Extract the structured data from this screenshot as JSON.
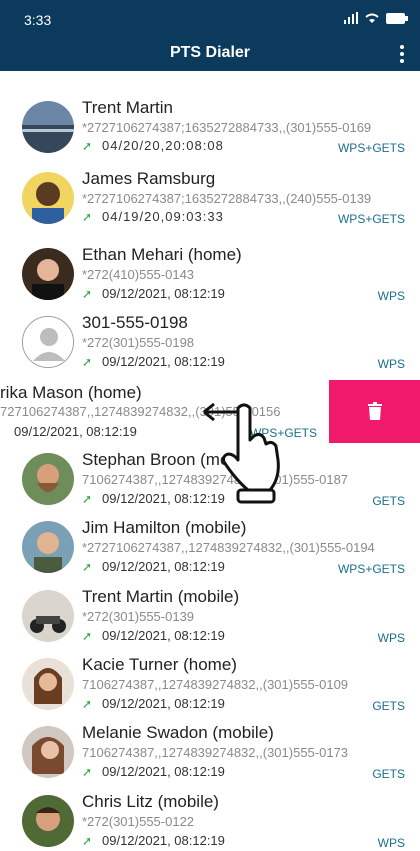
{
  "status": {
    "time": "3:33"
  },
  "appbar": {
    "title": "PTS Dialer"
  },
  "contacts": [
    {
      "name": "Trent Martin",
      "number": "*2727106274387;1635272884733,,(301)555-0169",
      "date": "04/20/20,20:08:08",
      "tag": "WPS+GETS"
    },
    {
      "name": "James Ramsburg",
      "number": "*2727106274387;1635272884733,,(240)555-0139",
      "date": "04/19/20,09:03:33",
      "tag": "WPS+GETS"
    },
    {
      "name": "Ethan Mehari (home)",
      "number": "*272(410)555-0143",
      "date": "09/12/2021, 08:12:19",
      "tag": "WPS"
    },
    {
      "name": "301-555-0198",
      "number": "*272(301)555-0198",
      "date": "09/12/2021, 08:12:19",
      "tag": "WPS"
    },
    {
      "name": "rika Mason (home)",
      "number": "727106274387,,1274839274832,,(301)555-0156",
      "date": "09/12/2021, 08:12:19",
      "tag": "WPS+GETS"
    },
    {
      "name": "Stephan Broon (mobile)",
      "number": "7106274387,,1274839274832,,(301)555-0187",
      "date": "09/12/2021, 08:12:19",
      "tag": "GETS"
    },
    {
      "name": "Jim Hamilton (mobile)",
      "number": "*2727106274387,,1274839274832,,(301)555-0194",
      "date": "09/12/2021, 08:12:19",
      "tag": "WPS+GETS"
    },
    {
      "name": "Trent Martin (mobile)",
      "number": "*272(301)555-0139",
      "date": "09/12/2021, 08:12:19",
      "tag": "WPS"
    },
    {
      "name": "Kacie Turner (home)",
      "number": "7106274387,,1274839274832,,(301)555-0109",
      "date": "09/12/2021, 08:12:19",
      "tag": "GETS"
    },
    {
      "name": "Melanie Swadon (mobile)",
      "number": "7106274387,,1274839274832,,(301)555-0173",
      "date": "09/12/2021, 08:12:19",
      "tag": "GETS"
    },
    {
      "name": "Chris Litz (mobile)",
      "number": "*272(301)555-0122",
      "date": "09/12/2021, 08:12:19",
      "tag": "WPS"
    }
  ],
  "colors": {
    "header": "#0b3a5c",
    "delete": "#f0196b",
    "tag": "#1c6e8c",
    "arrow": "#2aa84a"
  },
  "icons": {
    "call_arrow": "outgoing-call-icon",
    "delete": "trash-icon",
    "menu": "more-vert-icon",
    "gesture": "swipe-left-hand-icon"
  }
}
